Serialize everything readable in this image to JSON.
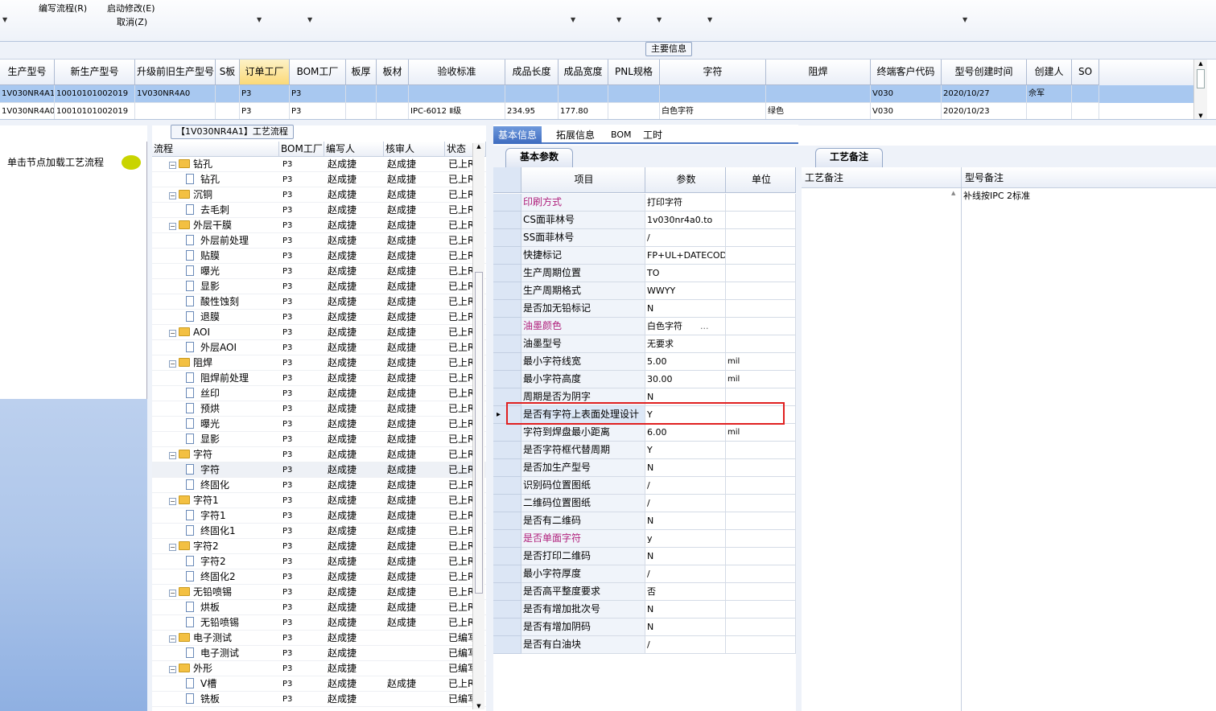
{
  "toolbar": {
    "row1": [
      "编写流程(R)",
      "启动修改(E)"
    ],
    "row2": [
      "取消(Z)"
    ]
  },
  "section_title": "主要信息",
  "top_grid": {
    "columns": [
      "生产型号",
      "新生产型号",
      "升级前旧生产型号",
      "S板",
      "订单工厂",
      "BOM工厂",
      "板厚",
      "板材",
      "验收标准",
      "成品长度",
      "成品宽度",
      "PNL规格",
      "字符",
      "阻焊",
      "终端客户代码",
      "型号创建时间",
      "创建人",
      "SO"
    ],
    "rows": [
      [
        "1V030NR4A1",
        "10010101002019",
        "1V030NR4A0",
        "",
        "P3",
        "P3",
        "",
        "",
        "",
        "",
        "",
        "",
        "",
        "",
        "V030",
        "2020/10/27",
        "佘军",
        ""
      ],
      [
        "1V030NR4A0",
        "10010101002019",
        "",
        "",
        "P3",
        "P3",
        "",
        "",
        "IPC-6012 Ⅱ级",
        "234.95",
        "177.80",
        "",
        "白色字符",
        "绿色",
        "V030",
        "2020/10/23",
        "",
        ""
      ]
    ]
  },
  "left_panel": {
    "hint": "单击节点加载工艺流程"
  },
  "tree_tab": "【1V030NR4A1】工艺流程",
  "tree": {
    "columns": [
      "流程",
      "BOM工厂",
      "编写人",
      "核审人",
      "状态"
    ],
    "rows": [
      {
        "name": "钻孔",
        "lvl": 0,
        "bom": "P3",
        "w": "赵成捷",
        "r": "赵成捷",
        "s": "已上R"
      },
      {
        "name": "钻孔",
        "lvl": 1,
        "bom": "P3",
        "w": "赵成捷",
        "r": "赵成捷",
        "s": "已上R"
      },
      {
        "name": "沉铜",
        "lvl": 0,
        "bom": "P3",
        "w": "赵成捷",
        "r": "赵成捷",
        "s": "已上R"
      },
      {
        "name": "去毛刺",
        "lvl": 1,
        "bom": "P3",
        "w": "赵成捷",
        "r": "赵成捷",
        "s": "已上R"
      },
      {
        "name": "外层干膜",
        "lvl": 0,
        "bom": "P3",
        "w": "赵成捷",
        "r": "赵成捷",
        "s": "已上R"
      },
      {
        "name": "外层前处理",
        "lvl": 1,
        "bom": "P3",
        "w": "赵成捷",
        "r": "赵成捷",
        "s": "已上R"
      },
      {
        "name": "贴膜",
        "lvl": 1,
        "bom": "P3",
        "w": "赵成捷",
        "r": "赵成捷",
        "s": "已上R"
      },
      {
        "name": "曝光",
        "lvl": 1,
        "bom": "P3",
        "w": "赵成捷",
        "r": "赵成捷",
        "s": "已上R"
      },
      {
        "name": "显影",
        "lvl": 1,
        "bom": "P3",
        "w": "赵成捷",
        "r": "赵成捷",
        "s": "已上R"
      },
      {
        "name": "酸性蚀刻",
        "lvl": 1,
        "bom": "P3",
        "w": "赵成捷",
        "r": "赵成捷",
        "s": "已上R"
      },
      {
        "name": "退膜",
        "lvl": 1,
        "bom": "P3",
        "w": "赵成捷",
        "r": "赵成捷",
        "s": "已上R"
      },
      {
        "name": "AOI",
        "lvl": 0,
        "bom": "P3",
        "w": "赵成捷",
        "r": "赵成捷",
        "s": "已上R"
      },
      {
        "name": "外层AOI",
        "lvl": 1,
        "bom": "P3",
        "w": "赵成捷",
        "r": "赵成捷",
        "s": "已上R"
      },
      {
        "name": "阻焊",
        "lvl": 0,
        "bom": "P3",
        "w": "赵成捷",
        "r": "赵成捷",
        "s": "已上R"
      },
      {
        "name": "阻焊前处理",
        "lvl": 1,
        "bom": "P3",
        "w": "赵成捷",
        "r": "赵成捷",
        "s": "已上R"
      },
      {
        "name": "丝印",
        "lvl": 1,
        "bom": "P3",
        "w": "赵成捷",
        "r": "赵成捷",
        "s": "已上R"
      },
      {
        "name": "预烘",
        "lvl": 1,
        "bom": "P3",
        "w": "赵成捷",
        "r": "赵成捷",
        "s": "已上R"
      },
      {
        "name": "曝光",
        "lvl": 1,
        "bom": "P3",
        "w": "赵成捷",
        "r": "赵成捷",
        "s": "已上R"
      },
      {
        "name": "显影",
        "lvl": 1,
        "bom": "P3",
        "w": "赵成捷",
        "r": "赵成捷",
        "s": "已上R"
      },
      {
        "name": "字符",
        "lvl": 0,
        "bom": "P3",
        "w": "赵成捷",
        "r": "赵成捷",
        "s": "已上R"
      },
      {
        "name": "字符",
        "lvl": 1,
        "bom": "P3",
        "w": "赵成捷",
        "r": "赵成捷",
        "s": "已上R",
        "sel": true
      },
      {
        "name": "终固化",
        "lvl": 1,
        "bom": "P3",
        "w": "赵成捷",
        "r": "赵成捷",
        "s": "已上R"
      },
      {
        "name": "字符1",
        "lvl": 0,
        "bom": "P3",
        "w": "赵成捷",
        "r": "赵成捷",
        "s": "已上R"
      },
      {
        "name": "字符1",
        "lvl": 1,
        "bom": "P3",
        "w": "赵成捷",
        "r": "赵成捷",
        "s": "已上R"
      },
      {
        "name": "终固化1",
        "lvl": 1,
        "bom": "P3",
        "w": "赵成捷",
        "r": "赵成捷",
        "s": "已上R"
      },
      {
        "name": "字符2",
        "lvl": 0,
        "bom": "P3",
        "w": "赵成捷",
        "r": "赵成捷",
        "s": "已上R"
      },
      {
        "name": "字符2",
        "lvl": 1,
        "bom": "P3",
        "w": "赵成捷",
        "r": "赵成捷",
        "s": "已上R"
      },
      {
        "name": "终固化2",
        "lvl": 1,
        "bom": "P3",
        "w": "赵成捷",
        "r": "赵成捷",
        "s": "已上R"
      },
      {
        "name": "无铅喷锡",
        "lvl": 0,
        "bom": "P3",
        "w": "赵成捷",
        "r": "赵成捷",
        "s": "已上R"
      },
      {
        "name": "烘板",
        "lvl": 1,
        "bom": "P3",
        "w": "赵成捷",
        "r": "赵成捷",
        "s": "已上R"
      },
      {
        "name": "无铅喷锡",
        "lvl": 1,
        "bom": "P3",
        "w": "赵成捷",
        "r": "赵成捷",
        "s": "已上R"
      },
      {
        "name": "电子测试",
        "lvl": 0,
        "bom": "P3",
        "w": "赵成捷",
        "r": "",
        "s": "已编写"
      },
      {
        "name": "电子测试",
        "lvl": 1,
        "bom": "P3",
        "w": "赵成捷",
        "r": "",
        "s": "已编写"
      },
      {
        "name": "外形",
        "lvl": 0,
        "bom": "P3",
        "w": "赵成捷",
        "r": "",
        "s": "已编写"
      },
      {
        "name": "V槽",
        "lvl": 1,
        "bom": "P3",
        "w": "赵成捷",
        "r": "赵成捷",
        "s": "已上R"
      },
      {
        "name": "铣板",
        "lvl": 1,
        "bom": "P3",
        "w": "赵成捷",
        "r": "",
        "s": "已编写"
      }
    ]
  },
  "mid_tabs": [
    "基本信息",
    "拓展信息",
    "BOM",
    "工时"
  ],
  "basic_params_tab": "基本参数",
  "params": {
    "columns": [
      "项目",
      "参数",
      "单位"
    ],
    "rows": [
      {
        "k": "印刷方式",
        "v": "打印字符",
        "u": "",
        "pink": true
      },
      {
        "k": "CS面菲林号",
        "v": "1v030nr4a0.to",
        "u": ""
      },
      {
        "k": "SS面菲林号",
        "v": "/",
        "u": ""
      },
      {
        "k": "快捷标记",
        "v": "FP+UL+DATECODE",
        "u": ""
      },
      {
        "k": "生产周期位置",
        "v": "TO",
        "u": ""
      },
      {
        "k": "生产周期格式",
        "v": "WWYY",
        "u": ""
      },
      {
        "k": "是否加无铅标记",
        "v": "N",
        "u": ""
      },
      {
        "k": "油墨颜色",
        "v": "白色字符",
        "u": "",
        "pink": true,
        "dots": "..."
      },
      {
        "k": "油墨型号",
        "v": "无要求",
        "u": ""
      },
      {
        "k": "最小字符线宽",
        "v": "5.00",
        "u": "mil"
      },
      {
        "k": "最小字符高度",
        "v": "30.00",
        "u": "mil"
      },
      {
        "k": "周期是否为阴字",
        "v": "N",
        "u": ""
      },
      {
        "k": "是否有字符上表面处理设计",
        "v": "Y",
        "u": "",
        "cur": true
      },
      {
        "k": "字符到焊盘最小距离",
        "v": "6.00",
        "u": "mil"
      },
      {
        "k": "是否字符框代替周期",
        "v": "Y",
        "u": ""
      },
      {
        "k": "是否加生产型号",
        "v": "N",
        "u": ""
      },
      {
        "k": "识别码位置图纸",
        "v": "/",
        "u": ""
      },
      {
        "k": "二维码位置图纸",
        "v": "/",
        "u": ""
      },
      {
        "k": "是否有二维码",
        "v": "N",
        "u": ""
      },
      {
        "k": "是否单面字符",
        "v": "y",
        "u": "",
        "pink": true
      },
      {
        "k": "是否打印二维码",
        "v": "N",
        "u": ""
      },
      {
        "k": "最小字符厚度",
        "v": "/",
        "u": ""
      },
      {
        "k": "是否高平整度要求",
        "v": "否",
        "u": ""
      },
      {
        "k": "是否有增加批次号",
        "v": "N",
        "u": ""
      },
      {
        "k": "是否有增加阴码",
        "v": "N",
        "u": ""
      },
      {
        "k": "是否有白油块",
        "v": "/",
        "u": ""
      }
    ]
  },
  "remarks_tab": "工艺备注",
  "remarks": {
    "col1": "工艺备注",
    "col2": "型号备注",
    "model_note": "补线按IPC 2标准"
  },
  "colors": {
    "accent": "#3d6bbf",
    "selected_row": "#a8c8f0",
    "pink": "#b0207c",
    "highlight_box": "#e02020"
  }
}
